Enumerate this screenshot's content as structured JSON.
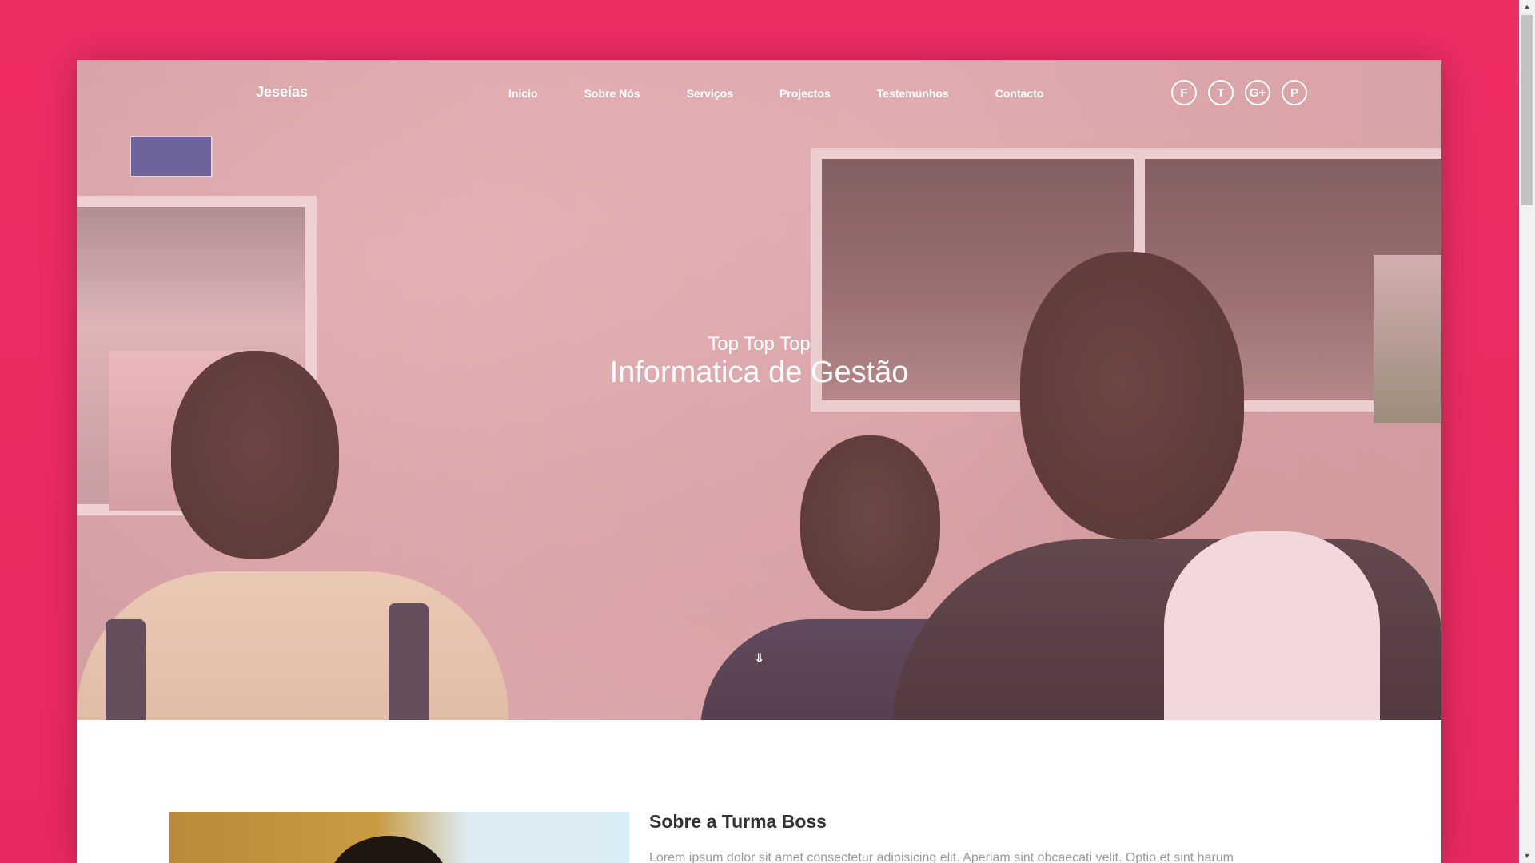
{
  "brand": "Jeseías",
  "nav": {
    "items": [
      "Inicio",
      "Sobre Nós",
      "Serviços",
      "Projectos",
      "Testemunhos",
      "Contacto"
    ]
  },
  "social": {
    "items": [
      {
        "label": "F",
        "icon": "facebook-icon"
      },
      {
        "label": "T",
        "icon": "twitter-icon"
      },
      {
        "label": "G+",
        "icon": "google-plus-icon"
      },
      {
        "label": "P",
        "icon": "pinterest-icon"
      }
    ]
  },
  "hero": {
    "subtitle": "Top Top Top",
    "title": "Informatica de Gestão",
    "scroll_glyph": "⇓"
  },
  "about": {
    "title": "Sobre a Turma Boss",
    "text": "Lorem ipsum dolor sit amet consectetur adipisicing elit. Aperiam sint obcaecati velit. Optio et sint harum"
  },
  "colors": {
    "page_background": "#ee2d63",
    "text_white": "#ffffff",
    "heading": "#333333",
    "body_text": "#9a9a9a"
  }
}
